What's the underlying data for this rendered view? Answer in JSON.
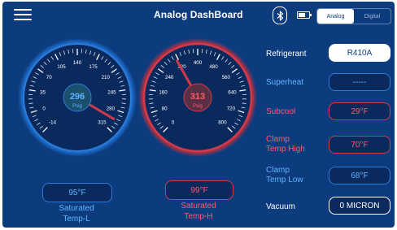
{
  "header": {
    "title": "Analog DashBoard",
    "menu_icon": "menu-icon",
    "bluetooth_icon": "bluetooth-icon",
    "battery_icon": "battery-icon",
    "mode_analog": "Analog",
    "mode_digital": "Digital",
    "active_mode": "Analog"
  },
  "gauge_low": {
    "value": "296",
    "unit": "Psig",
    "ticks": [
      "-14",
      "0",
      "35",
      "70",
      "105",
      "140",
      "175",
      "210",
      "245",
      "280",
      "315"
    ],
    "color": "#2c7bd6"
  },
  "gauge_high": {
    "value": "313",
    "unit": "Psig",
    "ticks": [
      "0",
      "80",
      "160",
      "240",
      "320",
      "400",
      "480",
      "560",
      "640",
      "720",
      "800"
    ],
    "color": "#d03a4a"
  },
  "saturated": {
    "low_value": "95°F",
    "low_label_1": "Saturated",
    "low_label_2": "Temp-L",
    "high_value": "99°F",
    "high_label_1": "Saturated",
    "high_label_2": "Temp-H"
  },
  "readings": {
    "refrigerant_label": "Refrigerant",
    "refrigerant_value": "R410A",
    "superheat_label": "Superheat",
    "superheat_value": "-----",
    "subcool_label": "Subcool",
    "subcool_value": "29°F",
    "clamp_high_label_1": "Clamp",
    "clamp_high_label_2": "Temp High",
    "clamp_high_value": "70°F",
    "clamp_low_label_1": "Clamp",
    "clamp_low_label_2": "Temp Low",
    "clamp_low_value": "68°F",
    "vacuum_label": "Vacuum",
    "vacuum_value": "0 MICRON"
  }
}
